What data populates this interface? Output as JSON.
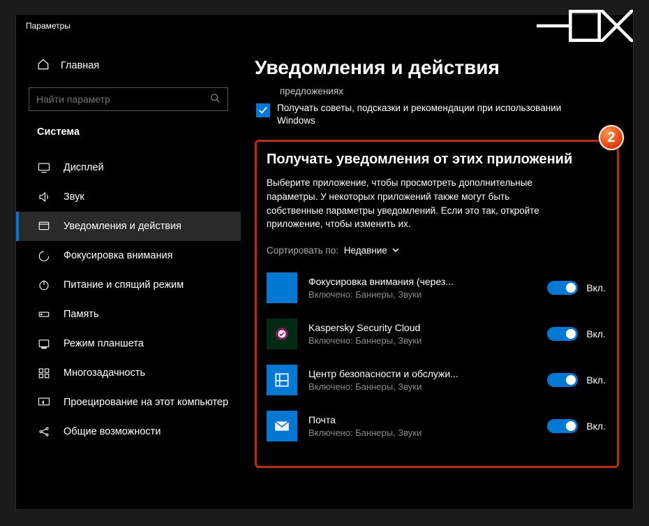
{
  "colors": {
    "accent": "#0078d4",
    "highlight": "#bf2a12"
  },
  "window": {
    "title": "Параметры"
  },
  "sidebar": {
    "home": "Главная",
    "search_placeholder": "Найти параметр",
    "category": "Система",
    "items": [
      {
        "label": "Дисплей",
        "icon": "display"
      },
      {
        "label": "Звук",
        "icon": "sound"
      },
      {
        "label": "Уведомления и действия",
        "icon": "notifications",
        "active": true
      },
      {
        "label": "Фокусировка внимания",
        "icon": "focus"
      },
      {
        "label": "Питание и спящий режим",
        "icon": "power"
      },
      {
        "label": "Память",
        "icon": "storage"
      },
      {
        "label": "Режим планшета",
        "icon": "tablet"
      },
      {
        "label": "Многозадачность",
        "icon": "multitask"
      },
      {
        "label": "Проецирование на этот компьютер",
        "icon": "project"
      },
      {
        "label": "Общие возможности",
        "icon": "shared"
      }
    ]
  },
  "main": {
    "title": "Уведомления и действия",
    "partial_check_text": "предложениях",
    "tips_check": "Получать советы, подсказки и рекомендации при использовании Windows",
    "badge": "2",
    "section_title": "Получать уведомления от этих приложений",
    "section_desc": "Выберите приложение, чтобы просмотреть дополнительные параметры. У некоторых приложений также могут быть собственные параметры уведомлений. Если это так, откройте приложение, чтобы изменить их.",
    "sort_label": "Сортировать по:",
    "sort_value": "Недавние",
    "apps": [
      {
        "name": "Фокусировка внимания (через...",
        "sub": "Включено: Баннеры, Звуки",
        "state": "Вкл.",
        "icon": "focus-blank"
      },
      {
        "name": "Kaspersky Security Cloud",
        "sub": "Включено: Баннеры, Звуки",
        "state": "Вкл.",
        "icon": "kaspersky"
      },
      {
        "name": "Центр безопасности и обслужи...",
        "sub": "Включено: Баннеры, Звуки",
        "state": "Вкл.",
        "icon": "security-center"
      },
      {
        "name": "Почта",
        "sub": "Включено: Баннеры, Звуки",
        "state": "Вкл.",
        "icon": "mail"
      }
    ]
  }
}
